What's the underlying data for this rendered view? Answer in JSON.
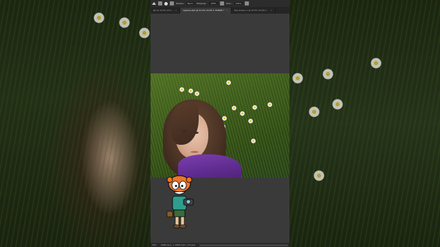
{
  "optionsBar": {
    "mode_label": "Режим:",
    "mode_value": "Выпл",
    "opacity_label": "Непрозр.:",
    "opacity_value": "100%",
    "flow_label": "Наж.:",
    "flow_value": "100%"
  },
  "tabs": [
    {
      "label": "Дн @ 12,5% (Cm...",
      "active": false
    },
    {
      "label": "мурика.psd @ 41,4% (Слой 1, RGB/8) *",
      "active": true
    },
    {
      "label": "Без имени-1 @ 33,3% (Слой 1...",
      "active": false
    }
  ],
  "statusbar": {
    "zoom": "34%",
    "doc_info": "1008 пикс. x 1008 пикс. (72 ppi)"
  },
  "colors": {
    "app_bg": "#3a3a3a",
    "options_bar": "#2c2c2c",
    "tab_bar": "#252525",
    "sweater": "#6a33a0"
  }
}
